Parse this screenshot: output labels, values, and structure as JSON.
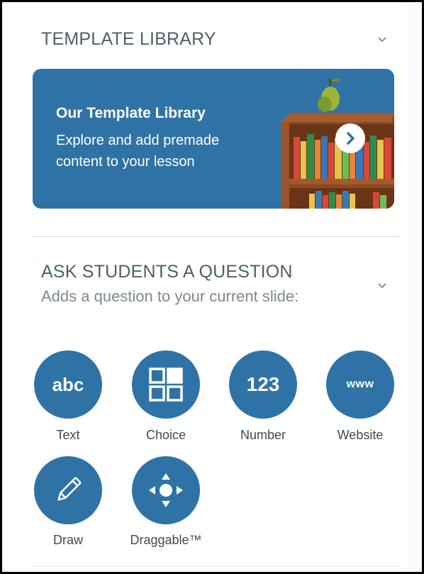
{
  "template_library": {
    "header": "TEMPLATE LIBRARY",
    "card_title": "Our Template Library",
    "card_description": "Explore and add premade content to your lesson"
  },
  "question": {
    "header": "ASK STUDENTS A QUESTION",
    "subtitle": "Adds a question to your current slide:",
    "types": [
      {
        "label": "Text",
        "icon": "abc",
        "icon_name": "abc-text-icon"
      },
      {
        "label": "Choice",
        "icon_name": "grid-choice-icon"
      },
      {
        "label": "Number",
        "icon": "123",
        "icon_name": "number-icon"
      },
      {
        "label": "Website",
        "icon": "www",
        "icon_name": "website-icon"
      },
      {
        "label": "Draw",
        "icon_name": "pencil-icon"
      },
      {
        "label": "Draggable™",
        "icon_name": "move-arrows-icon"
      }
    ]
  },
  "colors": {
    "accent_blue": "#2f73a6",
    "header_text": "#4b6266",
    "subtitle_text": "#7c8b8d"
  }
}
